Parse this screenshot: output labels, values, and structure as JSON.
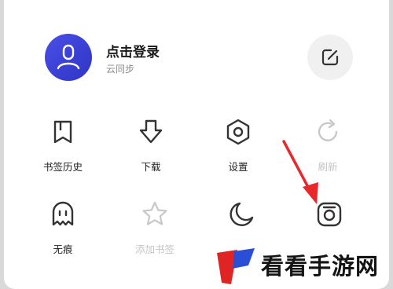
{
  "account": {
    "title": "点击登录",
    "subtitle": "云同步"
  },
  "icons": {
    "avatar": "user-avatar-icon",
    "edit": "edit-square-icon"
  },
  "grid": [
    {
      "label": "书签历史",
      "icon": "bookmark-icon",
      "enabled": true
    },
    {
      "label": "下载",
      "icon": "download-arrow-icon",
      "enabled": true
    },
    {
      "label": "设置",
      "icon": "settings-hexagon-icon",
      "enabled": true
    },
    {
      "label": "刷新",
      "icon": "refresh-icon",
      "enabled": false
    },
    {
      "label": "无痕",
      "icon": "ghost-icon",
      "enabled": true
    },
    {
      "label": "添加书签",
      "icon": "star-icon",
      "enabled": false
    },
    {
      "label": "",
      "icon": "moon-icon",
      "enabled": true
    },
    {
      "label": "",
      "icon": "camera-icon",
      "enabled": true
    }
  ],
  "annotation": {
    "color": "#e8282b"
  },
  "watermark": {
    "text": "看看手游网"
  },
  "colors": {
    "accent": "#3b40d6",
    "icon": "#333333",
    "disabled": "#c8c8c8"
  }
}
